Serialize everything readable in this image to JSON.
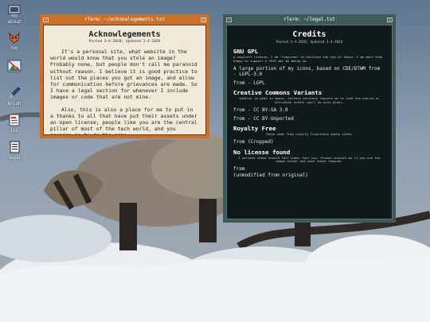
{
  "desktop": {
    "icons": [
      {
        "label": "about",
        "icon": "computer-icon"
      },
      {
        "label": "nio",
        "icon": "fox-icon"
      },
      {
        "label": "",
        "icon": "image-viewer-icon"
      },
      {
        "label": "brush",
        "icon": "brush-icon"
      },
      {
        "label": "rss",
        "icon": "notepad-icon"
      },
      {
        "label": "legal",
        "icon": "document-icon"
      }
    ]
  },
  "ack_window": {
    "title": "rTerm: ~/acknowlegements.txt",
    "heading": "Acknowlegements",
    "meta": "Posted 3-4-2020; Updated 3-4-2020",
    "paragraphs": [
      "It's a personal site, what website in the world would know that you stole an image? Probably none, but people don't call me paranoid without reason. I believe it is good practice to list out the places you got an image, and allow for communication before grievances are made. So I have a legal section for whenever I include images or code that are not mine.",
      "Also, this is also a place for me to put in a thanks to all that have put their assets under an open license; people like you are the central pillar of most of the tech world, and you inspire me to do the same."
    ],
    "frame_color": "#c9702c"
  },
  "legal_window": {
    "title": "rTerm: ~/legal.txt",
    "heading": "Credits",
    "meta": "Posted 3-4-2020; Updated 3-4-2020",
    "sections": {
      "gpl": {
        "heading": "GNU GPL",
        "note": "A copyleft license, I am \"required\" to disclose the use of these. I am more than happy to support a FOSS dev by doing so.",
        "para1_text": "A large portion of my icons, based on CDE/DTWM from",
        "para1_link": "                   ",
        "para1_suffix": " - LGPL-3.0",
        "para2_link": "                 ",
        "para2_mid": " from ",
        "para2_link2": "                  ",
        "para2_suffix": " - LGPL"
      },
      "cc": {
        "heading": "Creative Commons Variants",
        "note": "Similar to what is above, certain versions require me to link the source or attribute credit (will do with glee).",
        "line1_link": "                         ",
        "line1_mid": " from ",
        "line1_link2": "              ",
        "line1_suffix": " - CC BY-SA 3.0",
        "line2_link": "                          ",
        "line2_mid": " from ",
        "line2_link2": "    ",
        "line2_suffix": " - CC BY-Unported"
      },
      "royalty": {
        "heading": "Royalty Free",
        "note": "These come from royalty free/stock photo sites.",
        "line_link": "         ",
        "line_mid": " from ",
        "line_link2": "        ",
        "line_suffix": " (Cropped)"
      },
      "nolicense": {
        "heading": "No license found",
        "note": "I believe these should fall under fair use. Please contact me if you are the image holder and want these removed.",
        "line_link": "                     ",
        "line_mid": " from ",
        "line_link2": "                  ",
        "line_suffix": "(unmodified from original)"
      }
    },
    "frame_color": "#3f5a5a",
    "link_color": "#1b63a7"
  }
}
